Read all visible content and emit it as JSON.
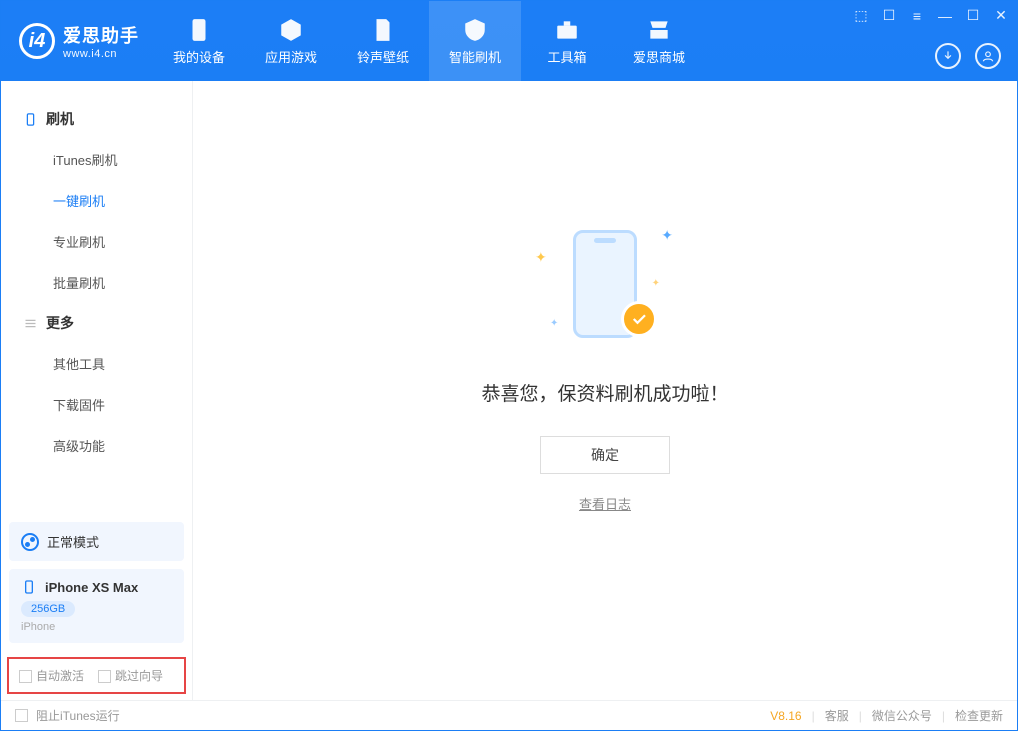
{
  "appName": "爱思助手",
  "appUrl": "www.i4.cn",
  "topTabs": [
    {
      "label": "我的设备"
    },
    {
      "label": "应用游戏"
    },
    {
      "label": "铃声壁纸"
    },
    {
      "label": "智能刷机"
    },
    {
      "label": "工具箱"
    },
    {
      "label": "爱思商城"
    }
  ],
  "sidebar": {
    "group1": {
      "title": "刷机",
      "items": [
        "iTunes刷机",
        "一键刷机",
        "专业刷机",
        "批量刷机"
      ]
    },
    "group2": {
      "title": "更多",
      "items": [
        "其他工具",
        "下载固件",
        "高级功能"
      ]
    }
  },
  "modeCard": {
    "label": "正常模式"
  },
  "deviceCard": {
    "name": "iPhone XS Max",
    "capacity": "256GB",
    "sub": "iPhone"
  },
  "bottomOptions": {
    "opt1": "自动激活",
    "opt2": "跳过向导"
  },
  "main": {
    "successMsg": "恭喜您，保资料刷机成功啦！",
    "okBtn": "确定",
    "logLink": "查看日志"
  },
  "footer": {
    "stopItunes": "阻止iTunes运行",
    "version": "V8.16",
    "links": [
      "客服",
      "微信公众号",
      "检查更新"
    ]
  }
}
